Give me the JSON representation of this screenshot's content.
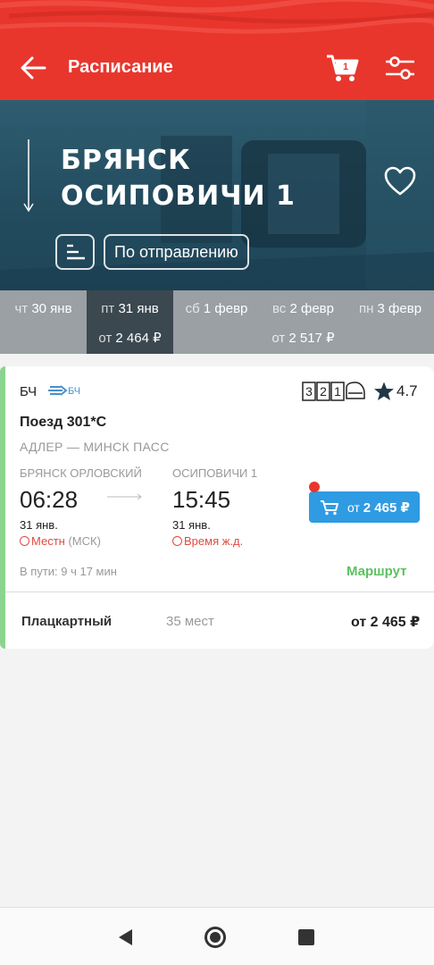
{
  "colors": {
    "brand": "#e8362d",
    "hero": "#234c5f",
    "date_strip": "#9aa0a4",
    "date_active": "#3b4850",
    "buy_button": "#2f9be3",
    "route_link": "#5cc160",
    "card_stripe": "#8bd48f",
    "tz_warning": "#e14a3f"
  },
  "toolbar": {
    "back_icon": "arrow-left-icon",
    "title": "Расписание",
    "cart_icon": "cart-icon",
    "cart_badge": "1",
    "filters_icon": "sliders-icon"
  },
  "hero": {
    "from": "БРЯНСК",
    "to": "ОСИПОВИЧИ 1",
    "favorite_icon": "heart-icon",
    "sort_icon": "sort-icon",
    "sort_label": "По отправлению"
  },
  "dates": [
    {
      "weekday": "чт",
      "date": "30 янв",
      "price_prefix": "",
      "price": "",
      "active": false
    },
    {
      "weekday": "пт",
      "date": "31 янв",
      "price_prefix": "от",
      "price": "2 464 ₽",
      "active": true
    },
    {
      "weekday": "сб",
      "date": "1 февр",
      "price_prefix": "",
      "price": "",
      "active": false
    },
    {
      "weekday": "вс",
      "date": "2 февр",
      "price_prefix": "от",
      "price": "2 517 ₽",
      "active": false
    },
    {
      "weekday": "пн",
      "date": "3 февр",
      "price_prefix": "",
      "price": "",
      "active": false
    }
  ],
  "train": {
    "carrier": "БЧ",
    "carrier_logo_text": "БЧ",
    "class_digits": [
      "3",
      "2",
      "1"
    ],
    "rating": "4.7",
    "name": "Поезд 301*С",
    "route": "АДЛЕР — МИНСК ПАСС",
    "from_station": "БРЯНСК ОРЛОВСКИЙ",
    "to_station": "ОСИПОВИЧИ 1",
    "departure_time": "06:28",
    "arrival_time": "15:45",
    "departure_date": "31 янв.",
    "arrival_date": "31 янв.",
    "departure_tz": "Местн",
    "departure_tz_suffix": "(МСК)",
    "arrival_tz": "Время ж.д.",
    "buy_prefix": "от",
    "buy_price": "2 465 ₽",
    "travel_time": "В пути: 9 ч 17 мин",
    "route_link": "Маршрут",
    "seat_class": "Плацкартный",
    "seat_count": "35 мест",
    "seat_price": "от 2 465 ₽"
  },
  "navbar": {
    "back_icon": "nav-back-icon",
    "home_icon": "nav-home-icon",
    "recent_icon": "nav-recent-icon"
  }
}
